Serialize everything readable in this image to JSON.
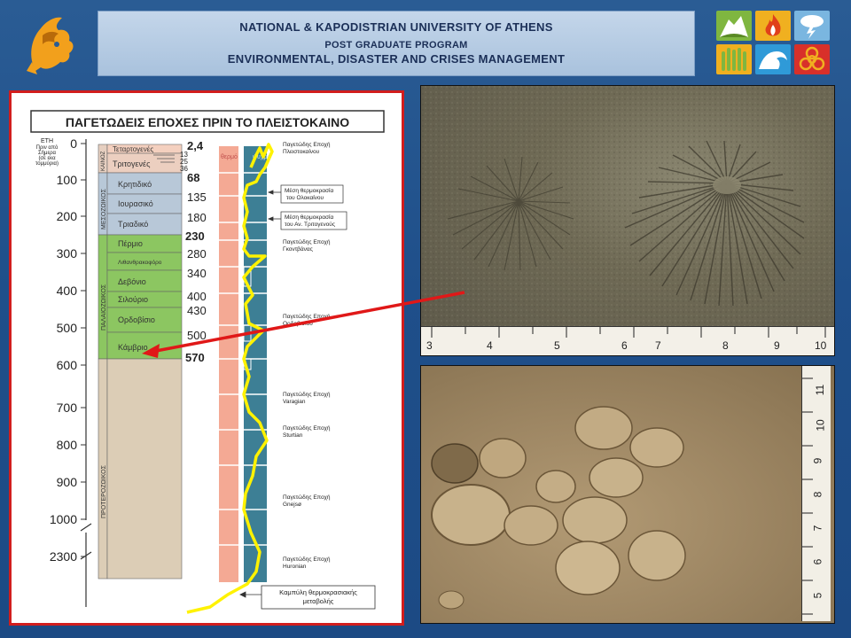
{
  "header": {
    "line1": "NATIONAL & KAPODISTRIAN UNIVERSITY OF ATHENS",
    "line2": "POST  GRADUATE   PROGRAM",
    "line3": "ENVIRONMENTAL, DISASTER AND CRISES MANAGEMENT"
  },
  "icons": [
    "mudslide-icon",
    "fire-icon",
    "storm-icon",
    "flood-icon",
    "tsunami-icon",
    "biohazard-icon"
  ],
  "colors": {
    "accent_red": "#d21d1d",
    "highlight_yellow": "#fff200",
    "cold_band": "#3d7f95",
    "warm_band": "#f4a994"
  },
  "chart": {
    "title": "ΠΑΓΕΤΩΔΕΙΣ ΕΠΟΧΕΣ ΠΡΙΝ ΤΟ ΠΛΕΙΣΤΟΚΑΙΝΟ",
    "axis_header": [
      "ΕΤΗ",
      "Πριν από",
      "Σήμερα",
      "(σε εκα",
      "τομμύρια)"
    ],
    "ticks": [
      "0",
      "100",
      "200",
      "300",
      "400",
      "500",
      "600",
      "700",
      "800",
      "900",
      "1000",
      "2300"
    ],
    "eras": {
      "cenozoic": "ΚΑΙΝΟΖ",
      "mesozoic": "ΜΕΣΟΖΩΙΚΟΣ",
      "paleozoic": "ΠΑΛΑΙΟΖΩΙΚΟΣ",
      "proterozoic": "ΠΡΟΤΕΡΟΖΩΙΚΟΣ"
    },
    "periods": [
      "Τεταρτογενές",
      "Τριτογενές",
      "Κρητιδικό",
      "Ιουρασικό",
      "Τριαδικό",
      "Πέρμιο",
      "Λιθανθρακοφόρο",
      "Δεβόνιο",
      "Σιλούριο",
      "Ορδοβίσιο",
      "Κάμβριο"
    ],
    "boundaries": [
      "2,4",
      "13",
      "25",
      "36",
      "68",
      "135",
      "180",
      "230",
      "280",
      "340",
      "400",
      "430",
      "500",
      "570"
    ],
    "band_labels": {
      "warm": "θερμό",
      "cold": "ψυχρό"
    },
    "annotations": [
      [
        "Παγετώδης Εποχή",
        "Πλειστοκαίνου"
      ],
      [
        "Μέση θερμοκρασία",
        "του Ολοκαίνου"
      ],
      [
        "Μέση θερμοκρασία",
        "του Αν. Τριτογενούς"
      ],
      [
        "Παγετώδης Εποχή",
        "Γκοντβάνας"
      ],
      [
        "Παγετώδης Εποχή",
        "Ορδοβισίου"
      ],
      [
        "Παγετώδης Εποχή",
        "Varagian"
      ],
      [
        "Παγετώδης Εποχή",
        "Sturtian"
      ],
      [
        "Παγετώδης Εποχή",
        "Gnejsø"
      ],
      [
        "Παγετώδης Εποχή",
        "Huronian"
      ]
    ],
    "curve_label": [
      "Καμπύλη θερμοκρασιακής",
      "μεταβολής"
    ]
  },
  "photo1": {
    "ruler": [
      "3",
      "4",
      "5",
      "6",
      "7",
      "8",
      "9",
      "10"
    ]
  },
  "photo2": {
    "ruler": [
      "5",
      "6",
      "7",
      "8",
      "9",
      "10",
      "11"
    ]
  }
}
